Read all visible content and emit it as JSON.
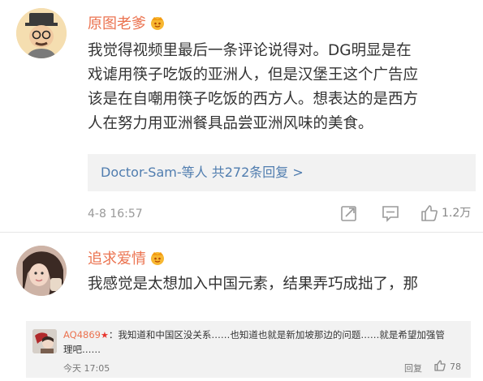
{
  "comment1": {
    "username": "原图老爹",
    "text_lines": [
      "我觉得视频里最后一条评论说得对。DG明显是在",
      "戏谑用筷子吃饭的亚洲人，但是汉堡王这个广告应",
      "该是在自嘲用筷子吃饭的西方人。想表达的是西方",
      "人在努力用亚洲餐具品尝亚洲风味的美食。"
    ],
    "replies_link": "Doctor-Sam-等人  共272条回复 >",
    "timestamp": "4-8 16:57",
    "likes": "1.2万",
    "icons": [
      "share-icon",
      "comment-icon",
      "like-icon"
    ]
  },
  "comment2": {
    "username": "追求爱情",
    "text": "我感觉是太想加入中国元素，结果弄巧成拙了，那"
  },
  "reply_box": {
    "nick": "AQ4869",
    "text_line1": "：我知道和中国区没关系……也知道也就是新加坡那边的问题……就是希望加强管",
    "text_line2": "理吧……",
    "time": "今天 17:05",
    "reply_label": "回复",
    "likes": "78"
  },
  "colors": {
    "accent": "#eb7350",
    "link": "#507daf"
  }
}
